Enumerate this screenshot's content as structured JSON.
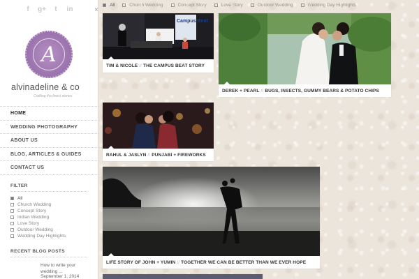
{
  "sidebar": {
    "social": [
      "f",
      "g+",
      "t",
      "in"
    ],
    "close": "×",
    "logo_letter": "A",
    "brand": "alvinadeline & co",
    "tagline": "Crafting the finest stories",
    "nav": [
      "HOME",
      "WEDDING PHOTOGRAPHY",
      "ABOUT US",
      "BLOG, ARTICLES & GUIDES",
      "CONTACT US"
    ],
    "filter_heading": "FILTER",
    "filters": [
      "All",
      "Church Wedding",
      "Concept Story",
      "Indian Wedding",
      "Love Story",
      "Outdoor Wedding",
      "Wedding Day Highlights"
    ],
    "recent_heading": "RECENT BLOG POSTS",
    "recent_post": {
      "title": "How to write your wedding ...",
      "date": "September 1, 2014"
    }
  },
  "topbar": [
    "All",
    "Church Wedding",
    "Concept Story",
    "Love Story",
    "Outdoor Wedding",
    "Wedding Day Highlights"
  ],
  "cards": [
    {
      "left": "TIM & NICOLE",
      "sep": "//",
      "right": "THE CAMPUS BEAT STORY",
      "screen_text": "Campus Beat"
    },
    {
      "left": "DEREK + PEARL",
      "sep": "//",
      "right": "BUGS, INSECTS, GUMMY BEARS & POTATO CHIPS"
    },
    {
      "left": "RAHUL & JASLYN",
      "sep": "//",
      "right": "PUNJABI + FIREWORKS"
    },
    {
      "left": "LIFE STORY OF JOHN + YUMIN",
      "sep": "//",
      "right": "TOGETHER WE CAN BE BETTER THAN WE EVER HOPE"
    }
  ],
  "colors": {
    "accent": "#9a72ad",
    "background": "#ece5dc"
  }
}
